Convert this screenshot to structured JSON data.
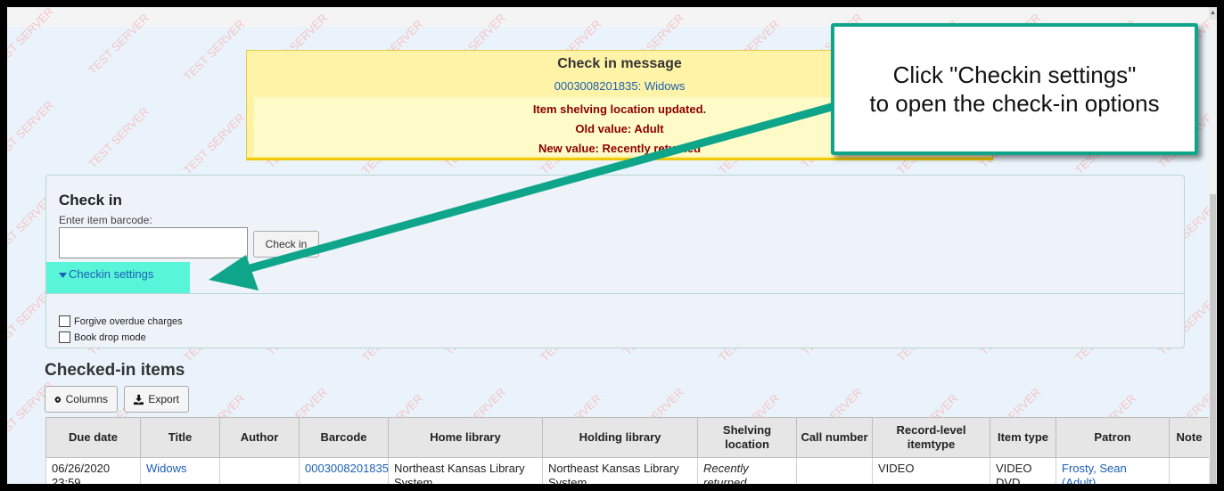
{
  "watermark": "TEST SERVER",
  "checkin_message": {
    "title": "Check in message",
    "item_link": "0003008201835: Widows",
    "lines": [
      "Item shelving location updated.",
      "Old value: Adult",
      "New value: Recently returned"
    ]
  },
  "checkin": {
    "title": "Check in",
    "barcode_label": "Enter item barcode:",
    "barcode_value": "",
    "submit_label": "Check in",
    "settings_toggle": "Checkin settings",
    "options": [
      {
        "label": "Forgive overdue charges",
        "checked": false
      },
      {
        "label": "Book drop mode",
        "checked": false
      }
    ]
  },
  "checked_in": {
    "title": "Checked-in items",
    "columns_button": "Columns",
    "export_button": "Export",
    "headers": [
      "Due date",
      "Title",
      "Author",
      "Barcode",
      "Home library",
      "Holding library",
      "Shelving location",
      "Call number",
      "Record-level itemtype",
      "Item type",
      "Patron",
      "Note"
    ],
    "rows": [
      [
        "06/26/2020 23:59",
        "Widows",
        "",
        "0003008201835",
        "Northeast Kansas Library System",
        "Northeast Kansas Library System",
        "Recently returned",
        "",
        "VIDEO",
        "VIDEO DVD",
        "Frosty, Sean (Adult)",
        ""
      ]
    ]
  },
  "tooltip": {
    "line1": "Click \"Checkin settings\"",
    "line2": "to open the check-in options"
  },
  "colors": {
    "accent": "#0fa58a",
    "highlight": "#58f5d9",
    "message_bg": "#fff3a7",
    "message_text": "#8b0000",
    "link": "#1a5fb4"
  }
}
